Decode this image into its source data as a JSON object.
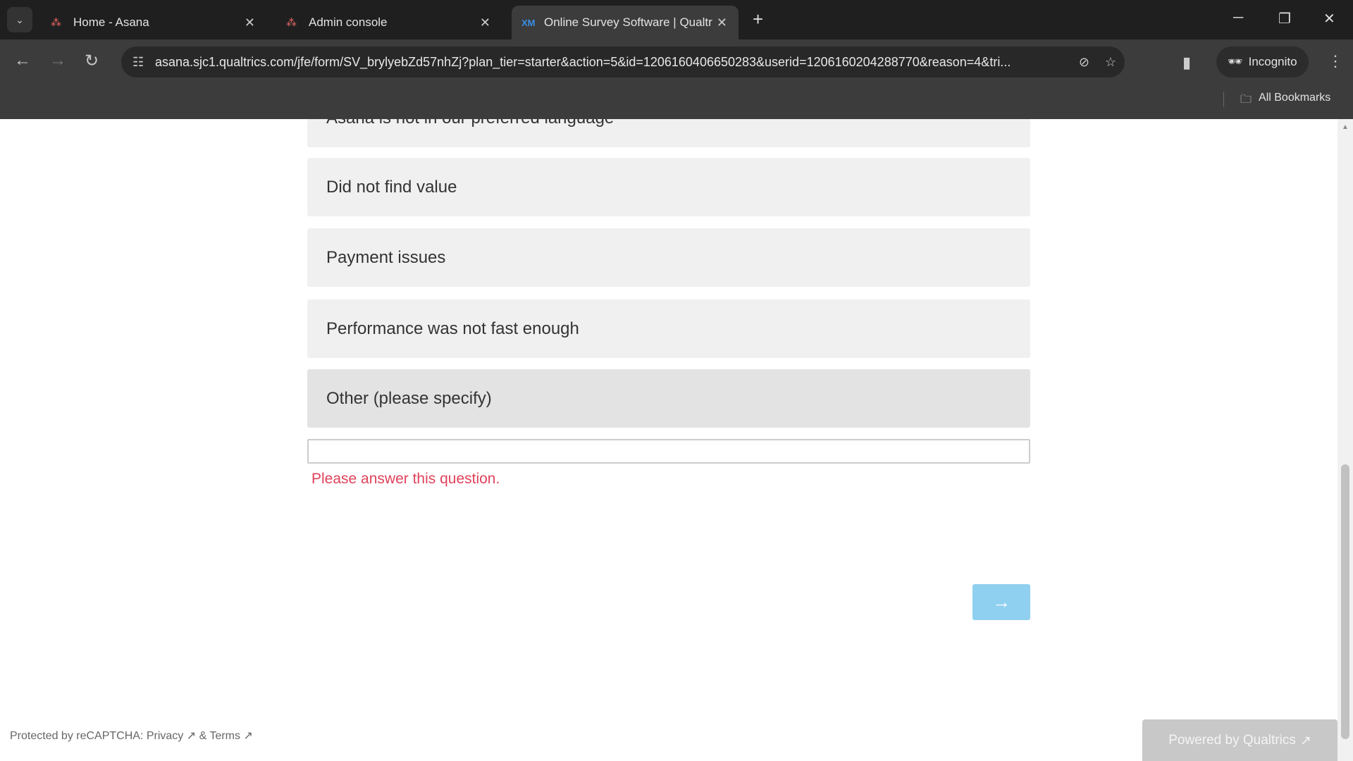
{
  "browser": {
    "tabs": [
      {
        "label": "Home - Asana",
        "icon": "asana-icon"
      },
      {
        "label": "Admin console",
        "icon": "asana-icon"
      },
      {
        "label": "Online Survey Software | Qualtr",
        "icon": "qualtrics-xm-icon",
        "active": true
      }
    ],
    "url": "asana.sjc1.qualtrics.com/jfe/form/SV_brylyebZd57nhZj?plan_tier=starter&action=5&id=1206160406650283&userid=1206160204288770&reason=4&tri...",
    "incognito_label": "Incognito",
    "bookmarks_label": "All Bookmarks"
  },
  "survey": {
    "options": [
      {
        "label": "Asana is not in our preferred language"
      },
      {
        "label": "Did not find value"
      },
      {
        "label": "Payment issues"
      },
      {
        "label": "Performance was not fast enough"
      },
      {
        "label": "Other (please specify)",
        "selected": true
      }
    ],
    "other_input_value": "",
    "error": "Please answer this question.",
    "next_label": "→",
    "error_color": "#e0425b",
    "next_color": "#8fd0f0"
  },
  "footer": {
    "recaptcha": "Protected by reCAPTCHA: ",
    "privacy": "Privacy",
    "and": " & ",
    "terms": "Terms",
    "powered": "Powered by Qualtrics"
  }
}
